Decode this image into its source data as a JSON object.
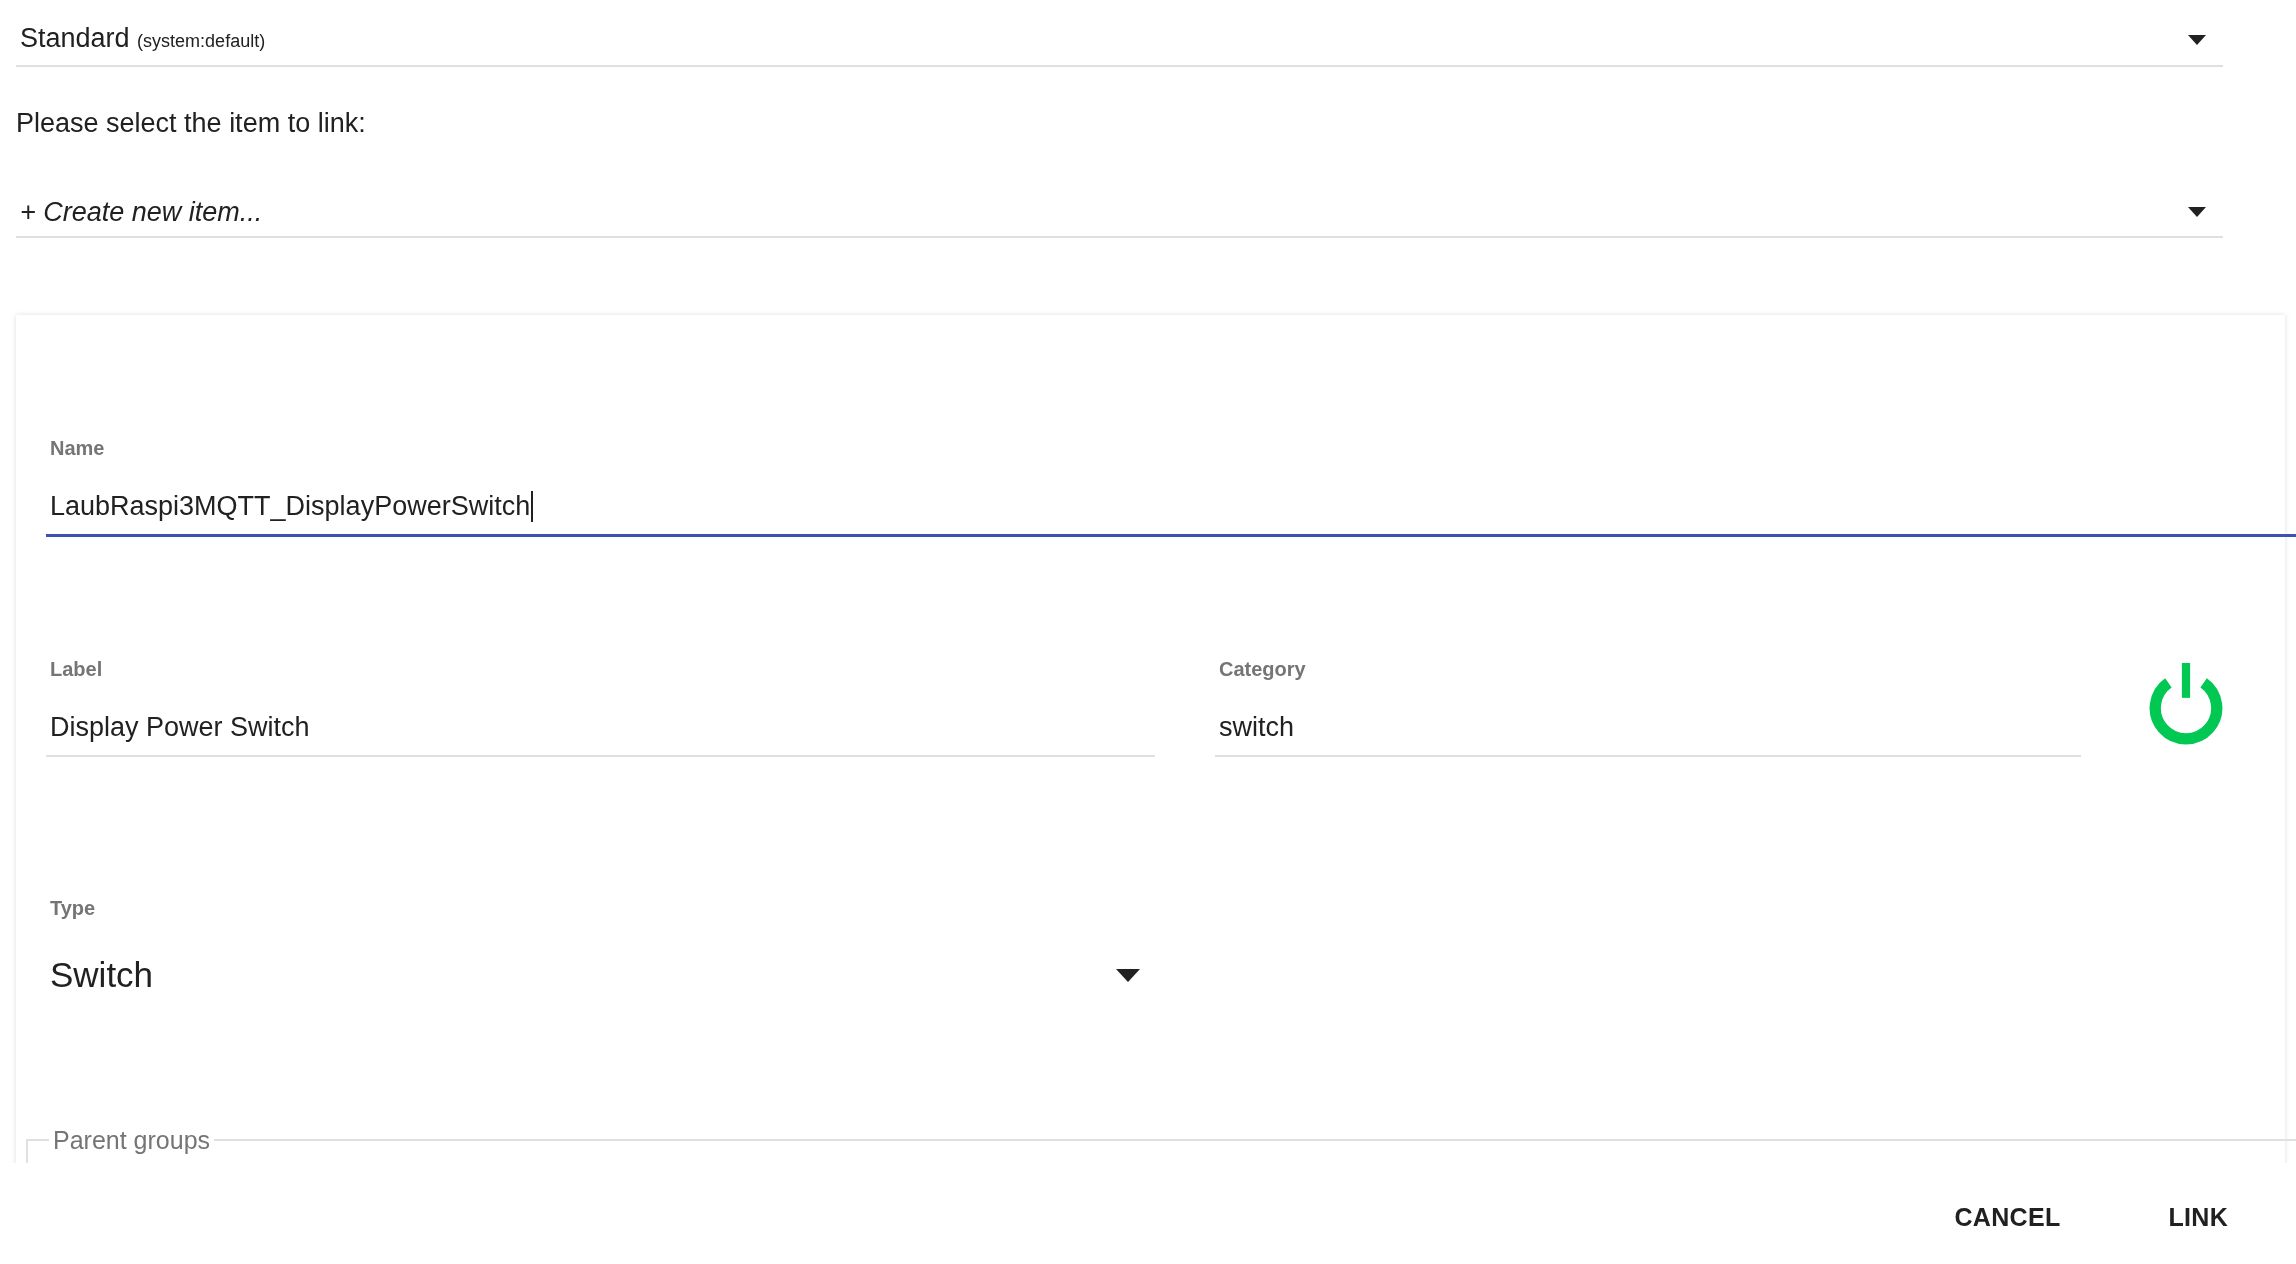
{
  "profile_select": {
    "value": "Standard",
    "detail": "(system:default)"
  },
  "prompt": "Please select the item to link:",
  "item_select": {
    "value": "+ Create new item..."
  },
  "item_form": {
    "fields": [
      {
        "kind": "text",
        "label": "Name",
        "value": "LaubRaspi3MQTT_DisplayPowerSwitch",
        "focused": true
      },
      {
        "kind": "text",
        "label": "Label",
        "value": "Display Power Switch",
        "focused": false
      },
      {
        "kind": "text",
        "label": "Category",
        "value": "switch",
        "focused": false
      },
      {
        "kind": "select",
        "label": "Type",
        "value": "Switch",
        "focused": false
      }
    ],
    "parent_groups": {
      "legend": "Parent groups"
    }
  },
  "buttons": [
    {
      "label": "CANCEL"
    },
    {
      "label": "LINK"
    }
  ]
}
